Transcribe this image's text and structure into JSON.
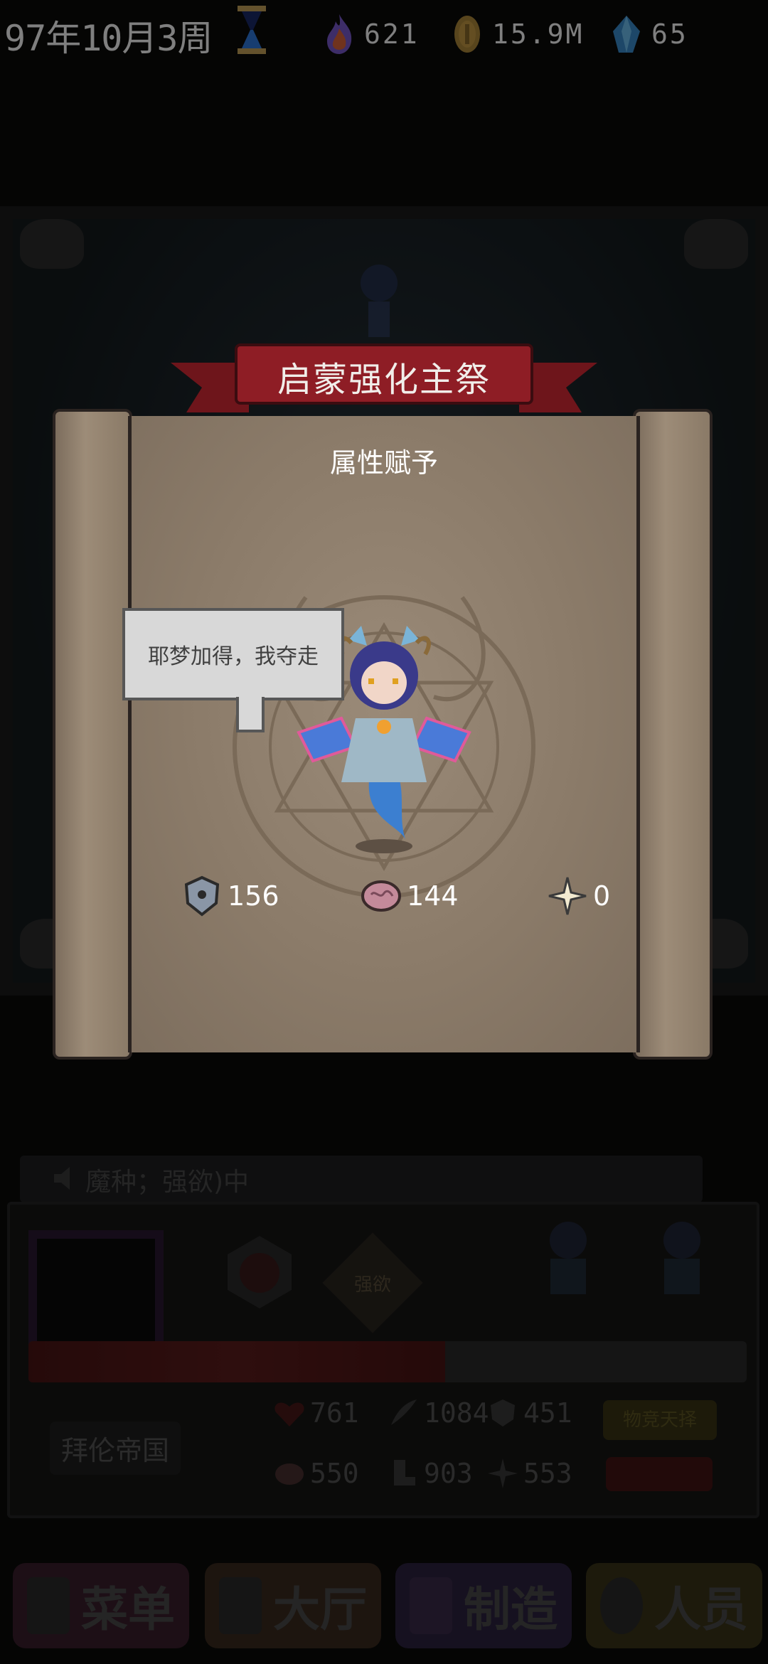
{
  "topbar": {
    "date": "97年10月3周",
    "flame": "621",
    "gold": "15.9M",
    "crystal": "65"
  },
  "dialog": {
    "banner_title": "启蒙强化主祭",
    "subtitle": "属性赋予",
    "speech": "耶梦加得，我夺走",
    "stats": {
      "defense": "156",
      "brain": "144",
      "sparkle": "0"
    }
  },
  "background": {
    "feed_text": "魔种；强欲)中",
    "emblem_label": "强欲",
    "faction": "拜伦帝国",
    "tag_yellow": "物竞天择",
    "stats": {
      "hp": "761",
      "attack": "1084",
      "defense": "451",
      "brain": "550",
      "boot": "903",
      "sparkle": "553"
    },
    "hp_fill": 0.58
  },
  "nav": {
    "menu": "菜单",
    "hall": "大厅",
    "craft": "制造",
    "staff": "人员"
  },
  "colors": {
    "banner": "#8e1d25",
    "parchment": "#8b7b69",
    "background": "#0b0a09"
  }
}
